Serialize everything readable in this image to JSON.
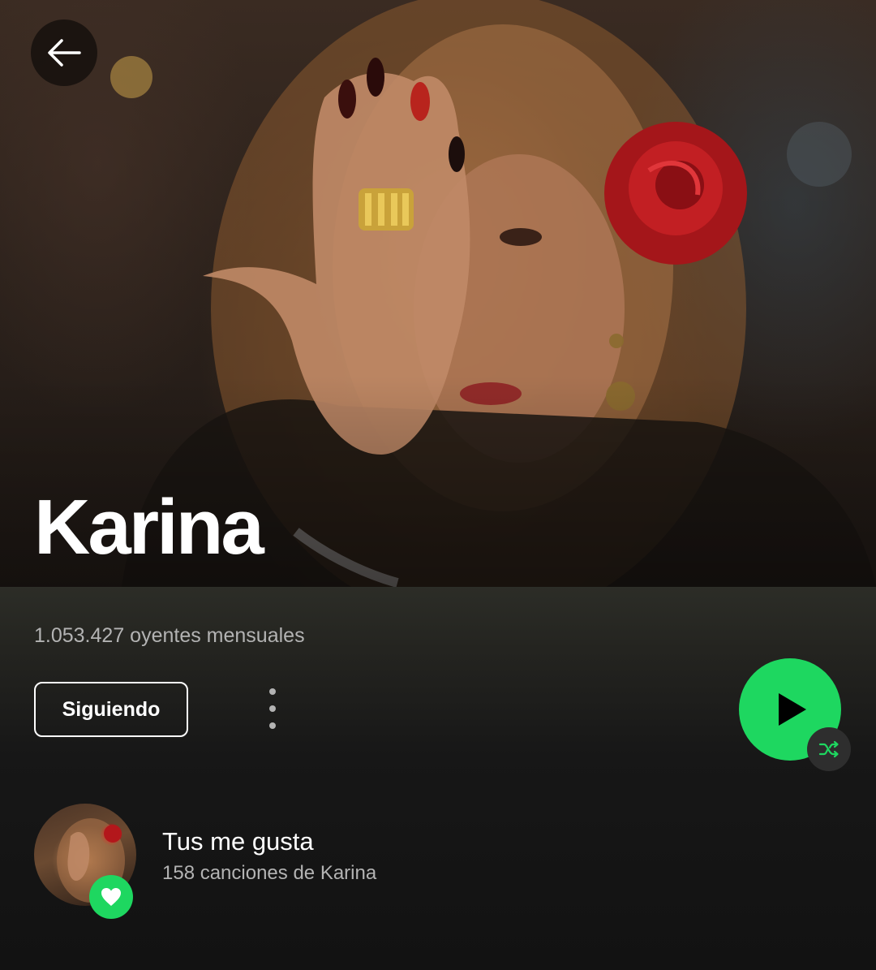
{
  "header": {
    "back_icon": "arrow-left-icon",
    "artist_name": "Karina"
  },
  "stats": {
    "monthly_listeners": "1.053.427 oyentes mensuales"
  },
  "actions": {
    "follow_label": "Siguiendo",
    "more_icon": "more-vertical-icon",
    "play_icon": "play-icon",
    "shuffle_icon": "shuffle-icon"
  },
  "liked_songs": {
    "title": "Tus me gusta",
    "subtitle": "158 canciones de Karina",
    "badge_icon": "heart-icon"
  },
  "colors": {
    "accent": "#1ed760",
    "background": "#121212",
    "secondary_text": "#b3b3b3"
  }
}
